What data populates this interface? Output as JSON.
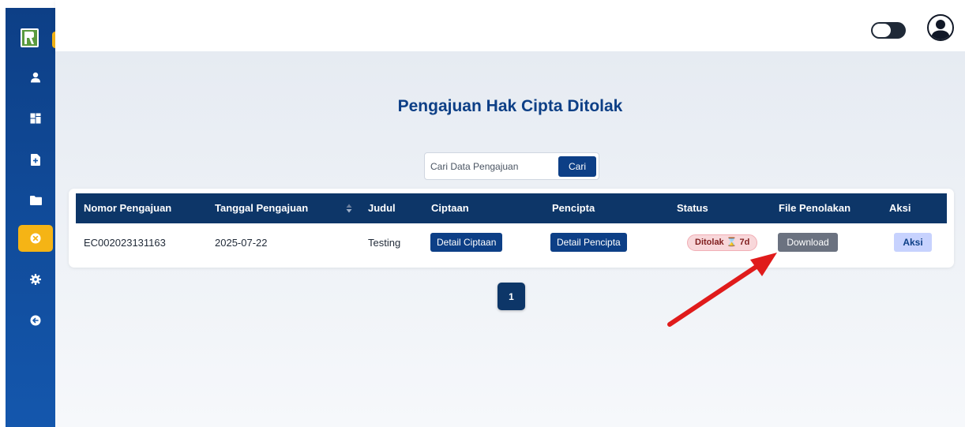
{
  "colors": {
    "sidebar": "#0d3f86",
    "accent": "#f5b415",
    "primary": "#0d3f86",
    "table_header": "#0d3668",
    "status_rejected_bg": "#f8d7da",
    "download_btn": "#6b7280",
    "annotation_arrow": "#e01b1b"
  },
  "sidebar": {
    "logo_icon": "logo-icon",
    "toggle_icon": "arrow-right-icon",
    "toggle_symbol": "→",
    "items": [
      {
        "name": "profile",
        "icon": "user-icon"
      },
      {
        "name": "dashboard",
        "icon": "dashboard-icon"
      },
      {
        "name": "add-submission",
        "icon": "file-plus-icon"
      },
      {
        "name": "folder",
        "icon": "folder-icon"
      },
      {
        "name": "rejected",
        "icon": "x-circle-icon",
        "active": true
      },
      {
        "name": "settings",
        "icon": "gear-icon"
      },
      {
        "name": "logout",
        "icon": "arrow-left-circle-icon"
      }
    ]
  },
  "topbar": {
    "theme_toggle_icon": "toggle-switch-icon",
    "avatar_icon": "user-circle-icon"
  },
  "main": {
    "title": "Pengajuan Hak Cipta Ditolak",
    "search": {
      "placeholder": "Cari Data Pengajuan",
      "value": "",
      "button_label": "Cari"
    },
    "table": {
      "headers": [
        "Nomor Pengajuan",
        "Tanggal Pengajuan",
        "Judul",
        "Ciptaan",
        "Pencipta",
        "Status",
        "File Penolakan",
        "Aksi"
      ],
      "rows": [
        {
          "nomor": "EC002023131163",
          "tanggal": "2025-07-22",
          "judul": "Testing",
          "ciptaan_label": "Detail Ciptaan",
          "pencipta_label": "Detail Pencipta",
          "status": "Ditolak ⌛ 7d",
          "file_label": "Download",
          "aksi_label": "Aksi"
        }
      ]
    },
    "pagination": {
      "current": "1"
    }
  }
}
